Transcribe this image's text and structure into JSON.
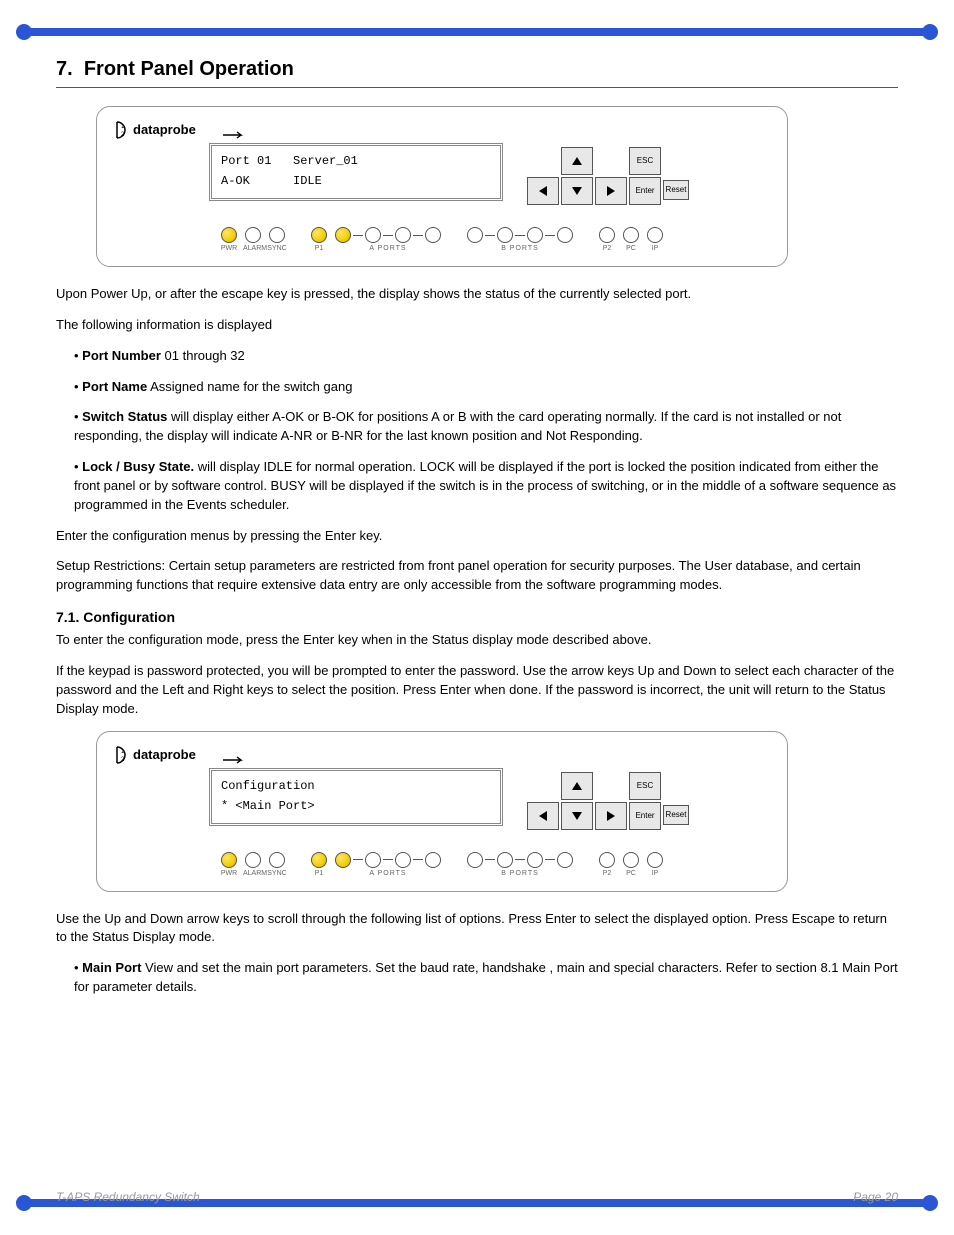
{
  "section_num": "7.",
  "section_title": "Front Panel Operation",
  "panel1": {
    "lcd_line1": "Port 01   Server_01",
    "lcd_line2": "A-OK      IDLE"
  },
  "panel2": {
    "lcd_line1": "Configuration",
    "lcd_line2": "* <Main Port>"
  },
  "keys": {
    "esc": "ESC",
    "enter": "Enter",
    "reset": "Reset"
  },
  "leds": [
    "PWR",
    "ALARM",
    "SYNC",
    "P1",
    "P2",
    "PC",
    "IP"
  ],
  "led_groups": [
    "A PORTS",
    "B PORTS"
  ],
  "body": {
    "p1": "Upon Power Up, or after the escape key is pressed, the display shows the status of the currently selected port.",
    "p2": "The following information is displayed",
    "li1": {
      "t": "Port Number",
      "d": "01 through 32"
    },
    "li2": {
      "t": "Port Name",
      "d": "Assigned name for the switch gang"
    },
    "li3": {
      "t": "Switch Status",
      "d": "will display either A-OK or B-OK for positions A or B with the card operating normally.  If the card is not installed or not responding, the display will indicate A-NR or B-NR for the last known position and Not Responding."
    },
    "li4": {
      "t": "Lock / Busy State.",
      "d": "will display IDLE for normal operation.   LOCK will be displayed if the port is locked the position indicated from either the front panel or by software control.  BUSY will be displayed if the switch is in the process of switching, or in the middle of a software sequence as programmed in the Events scheduler."
    },
    "p3": "Enter the configuration menus by pressing the Enter key.",
    "p4": "Setup Restrictions:  Certain setup parameters are restricted from front panel operation for security purposes.  The User database, and certain programming functions that require extensive data entry are only accessible from the software programming modes.",
    "p5": "To enter the configuration mode, press the Enter key when in the Status display mode described above.",
    "p6": "If the keypad is password protected, you will be prompted to enter the password.  Use the arrow keys Up and Down to select each character of the password and the Left and Right keys to select the position.   Press Enter when done. If the password is incorrect, the unit will return to the Status Display mode.",
    "p7": "Use the Up and Down arrow keys to scroll through the following list of options.  Press Enter to select the displayed option.  Press Escape to return to the Status Display mode.",
    "li5": {
      "t": "Main Port",
      "d": "View and set the main port parameters.  Set the baud rate, handshake , main and special characters.  Refer to section 8.1 Main Port for parameter details."
    }
  },
  "sub1": "7.1.  Configuration",
  "footer": {
    "left": "T-APS Redundancy Switch",
    "right_prefix": "Page",
    "right_page": "20"
  }
}
